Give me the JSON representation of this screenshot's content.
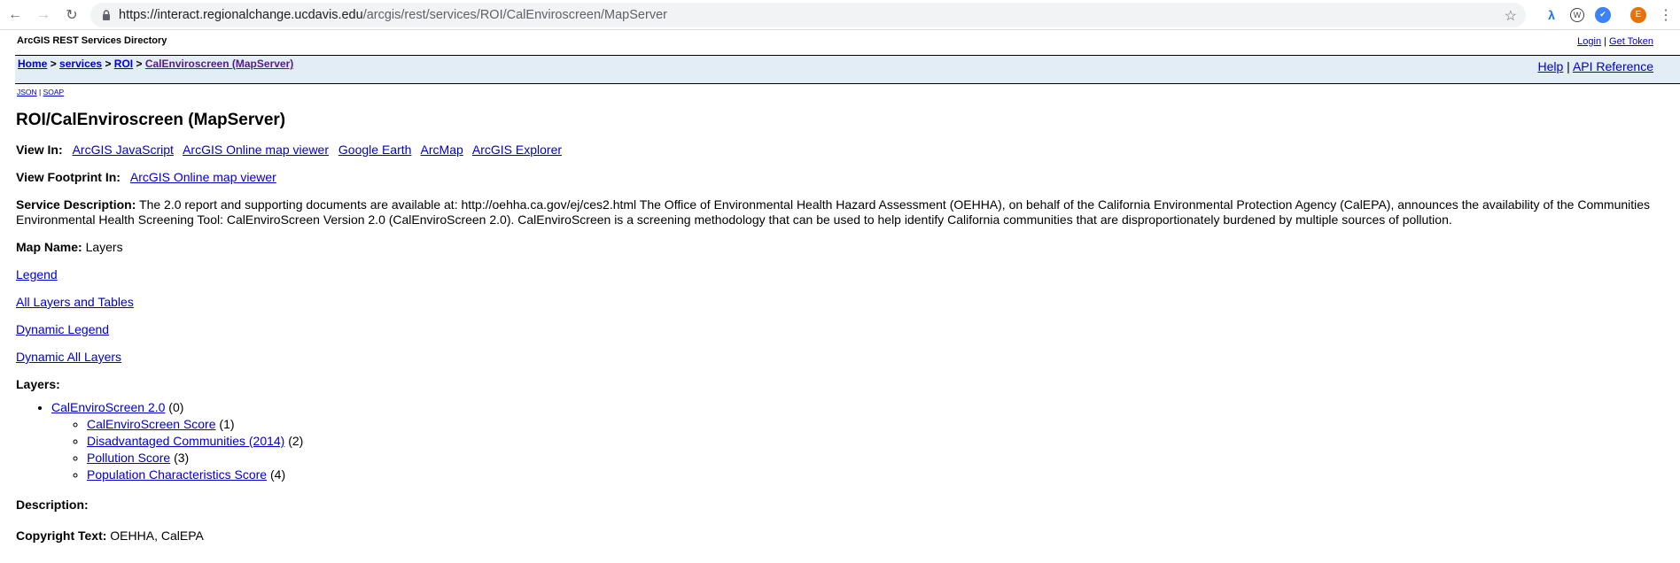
{
  "browser": {
    "url_host": "https://interact.regionalchange.ucdavis.edu",
    "url_path": "/arcgis/rest/services/ROI/CalEnviroscreen/MapServer",
    "profile_initial": "E"
  },
  "header": {
    "directory_title": "ArcGIS REST Services Directory",
    "login": "Login",
    "get_token": "Get Token"
  },
  "breadcrumb": {
    "home": "Home",
    "services": "services",
    "roi": "ROI",
    "current": "CalEnviroscreen (MapServer)",
    "sep": ">"
  },
  "help": {
    "help": "Help",
    "api_reference": "API Reference"
  },
  "formats": {
    "json": "JSON",
    "soap": "SOAP"
  },
  "main": {
    "title": "ROI/CalEnviroscreen (MapServer)",
    "view_in_label": "View In:",
    "view_in_links": [
      "ArcGIS JavaScript",
      "ArcGIS Online map viewer",
      "Google Earth",
      "ArcMap",
      "ArcGIS Explorer"
    ],
    "view_footprint_label": "View Footprint In:",
    "view_footprint_link": "ArcGIS Online map viewer",
    "service_description_label": "Service Description:",
    "service_description": "The 2.0 report and supporting documents are available at: http://oehha.ca.gov/ej/ces2.html The Office of Environmental Health Hazard Assessment (OEHHA), on behalf of the California Environmental Protection Agency (CalEPA), announces the availability of the Communities Environmental Health Screening Tool: CalEnviroScreen Version 2.0 (CalEnviroScreen 2.0). CalEnviroScreen is a screening methodology that can be used to help identify California communities that are disproportionately burdened by multiple sources of pollution.",
    "map_name_label": "Map Name:",
    "map_name": "Layers",
    "links": [
      "Legend",
      "All Layers and Tables",
      "Dynamic Legend",
      "Dynamic All Layers"
    ],
    "layers_label": "Layers:",
    "layers": {
      "parent": {
        "name": "CalEnviroScreen 2.0",
        "id": "(0)"
      },
      "children": [
        {
          "name": "CalEnviroScreen Score",
          "id": "(1)"
        },
        {
          "name": "Disadvantaged Communities (2014)",
          "id": "(2)"
        },
        {
          "name": "Pollution Score",
          "id": "(3)"
        },
        {
          "name": "Population Characteristics Score",
          "id": "(4)"
        }
      ]
    },
    "description_label": "Description:",
    "copyright_label": "Copyright Text:",
    "copyright_value": "OEHHA, CalEPA"
  }
}
